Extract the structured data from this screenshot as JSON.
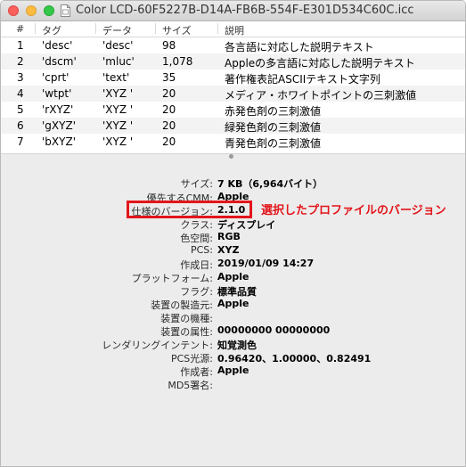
{
  "window": {
    "title": "Color LCD-60F5227B-D14A-FB6B-554F-E301D534C60C.icc",
    "icon": "document-icon"
  },
  "table": {
    "headers": [
      "#",
      "タグ",
      "データ",
      "サイズ",
      "説明"
    ],
    "rows": [
      [
        "1",
        "'desc'",
        "'desc'",
        "98",
        "各言語に対応した説明テキスト"
      ],
      [
        "2",
        "'dscm'",
        "'mluc'",
        "1,078",
        "Appleの多言語に対応した説明テキスト"
      ],
      [
        "3",
        "'cprt'",
        "'text'",
        "35",
        "著作権表記ASCIIテキスト文字列"
      ],
      [
        "4",
        "'wtpt'",
        "'XYZ '",
        "20",
        "メディア・ホワイトポイントの三刺激値"
      ],
      [
        "5",
        "'rXYZ'",
        "'XYZ '",
        "20",
        "赤発色剤の三刺激値"
      ],
      [
        "6",
        "'gXYZ'",
        "'XYZ '",
        "20",
        "緑発色剤の三刺激値"
      ],
      [
        "7",
        "'bXYZ'",
        "'XYZ '",
        "20",
        "青発色剤の三刺激値"
      ]
    ]
  },
  "info": {
    "fields": [
      {
        "label": "サイズ:",
        "value": "7 KB（6,964バイト）"
      },
      {
        "label": "優先するCMM:",
        "value": "Apple"
      },
      {
        "label": "仕様のバージョン:",
        "value": "2.1.0"
      },
      {
        "label": "クラス:",
        "value": "ディスプレイ"
      },
      {
        "label": "色空間:",
        "value": "RGB"
      },
      {
        "label": "PCS:",
        "value": "XYZ"
      },
      {
        "label": "作成日:",
        "value": "2019/01/09 14:27"
      },
      {
        "label": "プラットフォーム:",
        "value": "Apple"
      },
      {
        "label": "フラグ:",
        "value": "標準品質"
      },
      {
        "label": "装置の製造元:",
        "value": "Apple"
      },
      {
        "label": "装置の機種:",
        "value": ""
      },
      {
        "label": "装置の属性:",
        "value": "00000000 00000000"
      },
      {
        "label": "レンダリングインテント:",
        "value": "知覚測色"
      },
      {
        "label": "PCS光源:",
        "value": "0.96420、1.00000、0.82491"
      },
      {
        "label": "作成者:",
        "value": "Apple"
      },
      {
        "label": "MD5署名:",
        "value": ""
      }
    ]
  },
  "annotation": {
    "text": "選択したプロファイルのバージョン",
    "color": "#e3151b"
  }
}
